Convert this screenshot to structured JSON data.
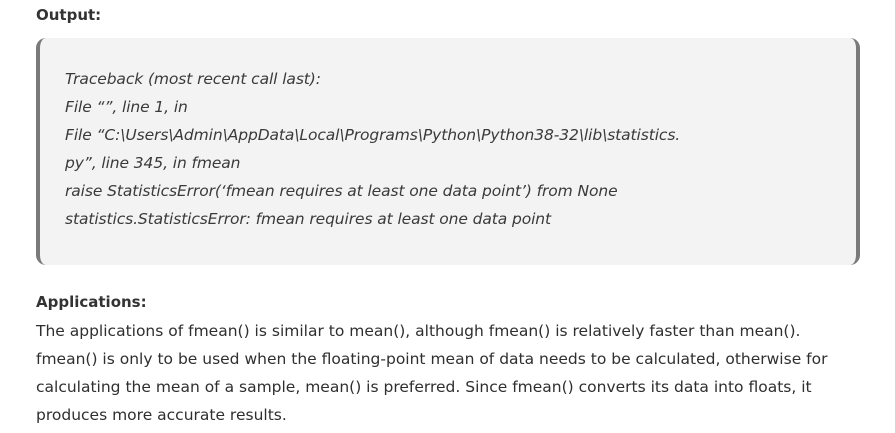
{
  "output": {
    "heading": "Output:",
    "lines": [
      "Traceback (most recent call last):",
      "File “”, line 1, in",
      "File “C:\\Users\\Admin\\AppData\\Local\\Programs\\Python\\Python38-32\\lib\\statistics.",
      "py”, line 345, in fmean",
      "raise StatisticsError(‘fmean requires at least one data point’) from None",
      "statistics.StatisticsError: fmean requires at least one data point"
    ]
  },
  "applications": {
    "heading": "Applications:",
    "text": "The applications of fmean() is similar to mean(), although fmean() is relatively faster than mean(). fmean() is only to be used when the floating-point mean of data needs to be calculated, otherwise for calculating the mean of a sample, mean() is preferred. Since fmean() converts its data into floats, it produces more accurate results."
  }
}
